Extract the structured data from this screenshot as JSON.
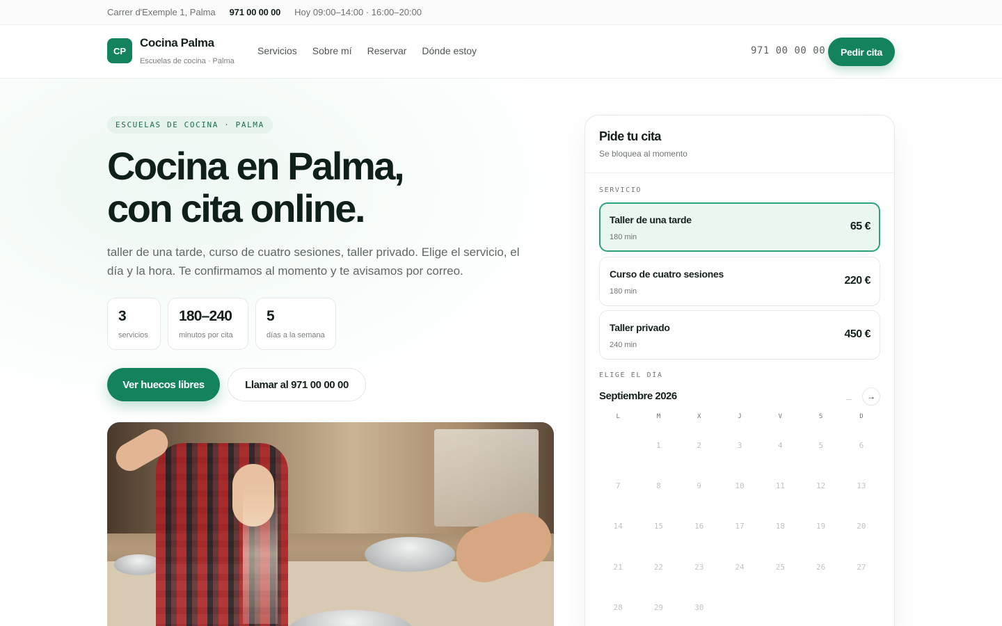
{
  "topbar": {
    "address": "Carrer d'Exemple 1, Palma",
    "phone": "971 00 00 00",
    "hours": "Hoy 09:00–14:00 · 16:00–20:00"
  },
  "header": {
    "logo_initials": "CP",
    "brand": "Cocina Palma",
    "tagline": "Escuelas de cocina · Palma",
    "nav": [
      "Servicios",
      "Sobre mí",
      "Reservar",
      "Dónde estoy"
    ],
    "phone": "971 00 00 00",
    "cta": "Pedir cita"
  },
  "hero": {
    "eyebrow": "ESCUELAS DE COCINA · PALMA",
    "title_line1": "Cocina en Palma,",
    "title_line2": "con cita online.",
    "description": "taller de una tarde, curso de cuatro sesiones, taller privado. Elige el servicio, el día y la hora. Te confirmamos al momento y te avisamos por correo.",
    "stats": [
      {
        "value": "3",
        "label": "servicios"
      },
      {
        "value": "180–240",
        "label": "minutos por cita"
      },
      {
        "value": "5",
        "label": "días a la semana"
      }
    ],
    "primary_button": "Ver huecos libres",
    "secondary_button": "Llamar al 971 00 00 00"
  },
  "booking": {
    "title": "Pide tu cita",
    "subtitle": "Se bloquea al momento",
    "service_label": "SERVICIO",
    "services": [
      {
        "name": "Taller de una tarde",
        "duration": "180 min",
        "price": "65 €",
        "selected": true
      },
      {
        "name": "Curso de cuatro sesiones",
        "duration": "180 min",
        "price": "220 €",
        "selected": false
      },
      {
        "name": "Taller privado",
        "duration": "240 min",
        "price": "450 €",
        "selected": false
      }
    ],
    "day_label": "ELIGE EL DÍA",
    "month": "Septiembre 2026",
    "prev_icon": "–",
    "next_icon": "→",
    "weekdays": [
      "L",
      "M",
      "X",
      "J",
      "V",
      "S",
      "D"
    ],
    "first_weekday_offset": 1,
    "days": [
      "1",
      "2",
      "3",
      "4",
      "5",
      "6",
      "7",
      "8",
      "9",
      "10",
      "11",
      "12",
      "13",
      "14",
      "15",
      "16",
      "17",
      "18",
      "19",
      "20",
      "21",
      "22",
      "23",
      "24",
      "25",
      "26",
      "27",
      "28",
      "29",
      "30"
    ]
  },
  "colors": {
    "accent": "#12835d",
    "accent_soft": "#eaf6f0",
    "text": "#14201b",
    "muted": "#6f7572"
  }
}
